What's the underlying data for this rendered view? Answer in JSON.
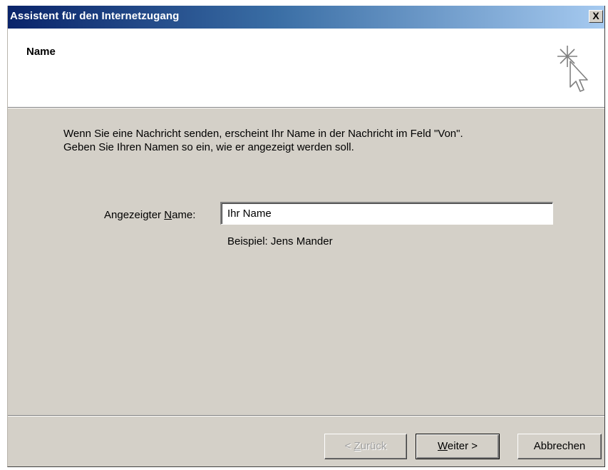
{
  "window": {
    "title": "Assistent für den Internetzugang",
    "close_label": "X"
  },
  "header": {
    "title": "Name",
    "icon": "wizard-cursor-sparkle-icon"
  },
  "description": {
    "line1": "Wenn Sie eine Nachricht senden, erscheint Ihr Name in der Nachricht im Feld \"Von\".",
    "line2": "Geben Sie Ihren Namen so ein, wie er angezeigt werden soll."
  },
  "form": {
    "name_label_prefix": "Angezeigter ",
    "name_label_accel": "N",
    "name_label_suffix": "ame:",
    "name_value": "Ihr Name",
    "example": "Beispiel: Jens Mander"
  },
  "buttons": {
    "back_prefix": "< ",
    "back_accel": "Z",
    "back_suffix": "urück",
    "next_accel": "W",
    "next_suffix": "eiter >",
    "cancel": "Abbrechen"
  },
  "colors": {
    "title_gradient_start": "#0a246a",
    "title_gradient_end": "#a6caf0",
    "dialog_face": "#d4d0c8",
    "header_bg": "#ffffff"
  }
}
